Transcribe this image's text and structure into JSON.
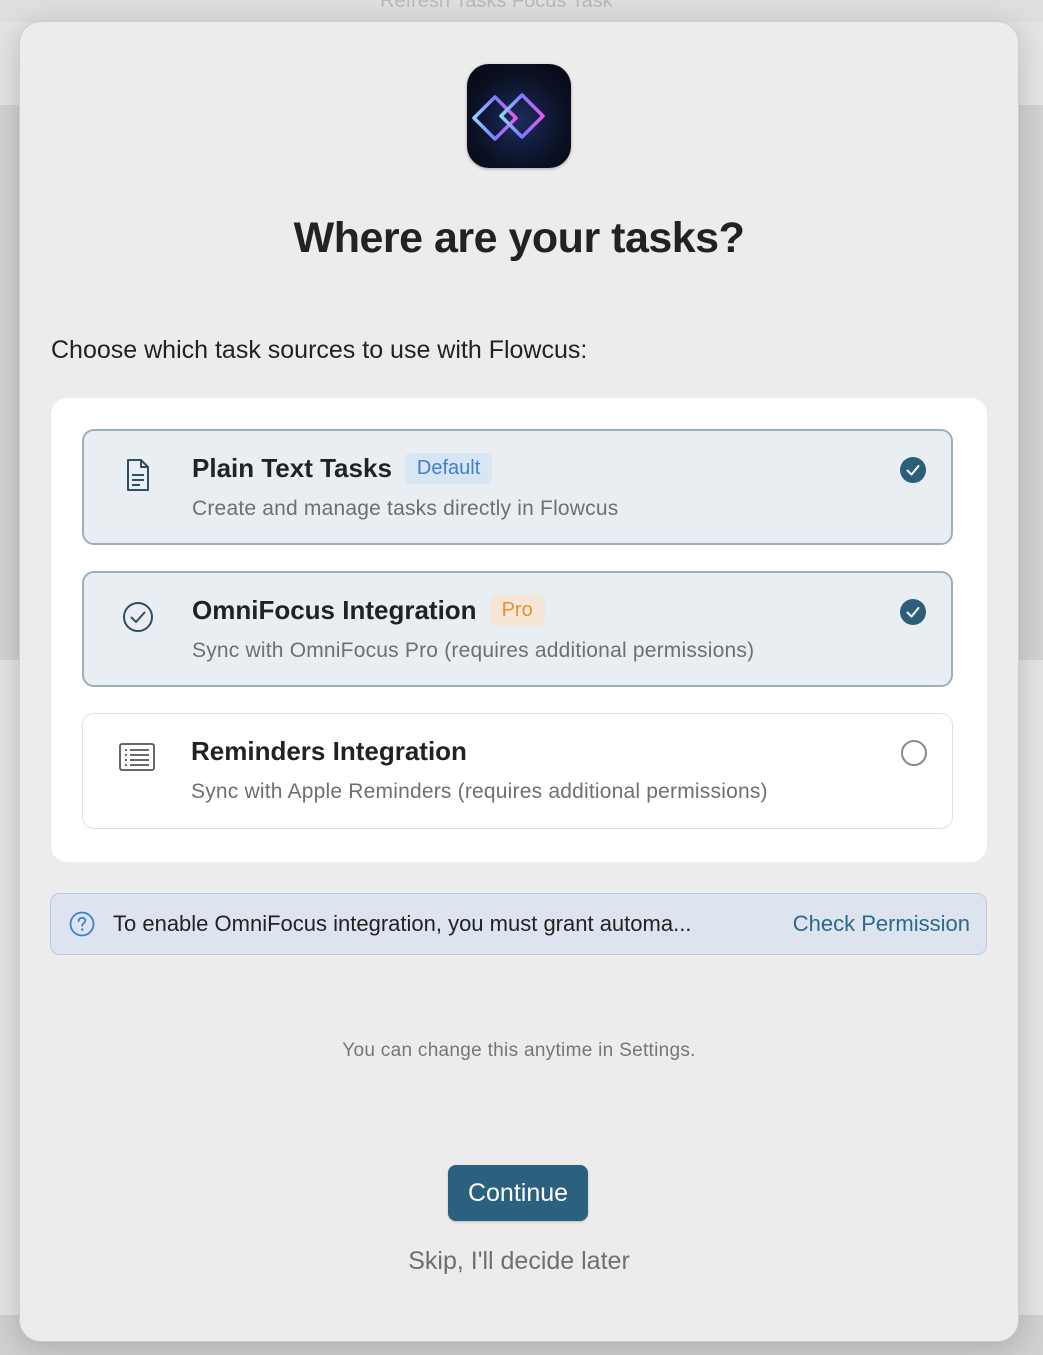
{
  "background": {
    "toolbar_text": "Refresh Tasks    Focus Task"
  },
  "sheet": {
    "app_icon": "flowcus-infinity-logo",
    "title": "Where are your tasks?",
    "subtitle": "Choose which task sources to use with Flowcus:",
    "options": [
      {
        "icon": "document-icon",
        "title": "Plain Text Tasks",
        "badge": "Default",
        "description": "Create and manage tasks directly in Flowcus",
        "selected": true
      },
      {
        "icon": "checkmark-circle-icon",
        "title": "OmniFocus Integration",
        "badge": "Pro",
        "description": "Sync with OmniFocus Pro (requires additional permissions)",
        "selected": true
      },
      {
        "icon": "list-icon",
        "title": "Reminders Integration",
        "badge": "",
        "description": "Sync with Apple Reminders (requires additional permissions)",
        "selected": false
      }
    ],
    "info": {
      "icon": "question-circle-icon",
      "text": "To enable OmniFocus integration, you must grant automa...",
      "link": "Check Permission"
    },
    "footnote": "You can change this anytime in Settings.",
    "continue_label": "Continue",
    "skip_label": "Skip, I'll decide later"
  },
  "colors": {
    "accent": "#2b617f",
    "selected_border": "#9bb0bd",
    "default_badge": "#3e7fd0",
    "pro_badge": "#e39335",
    "info_bg": "#dde3ef"
  }
}
